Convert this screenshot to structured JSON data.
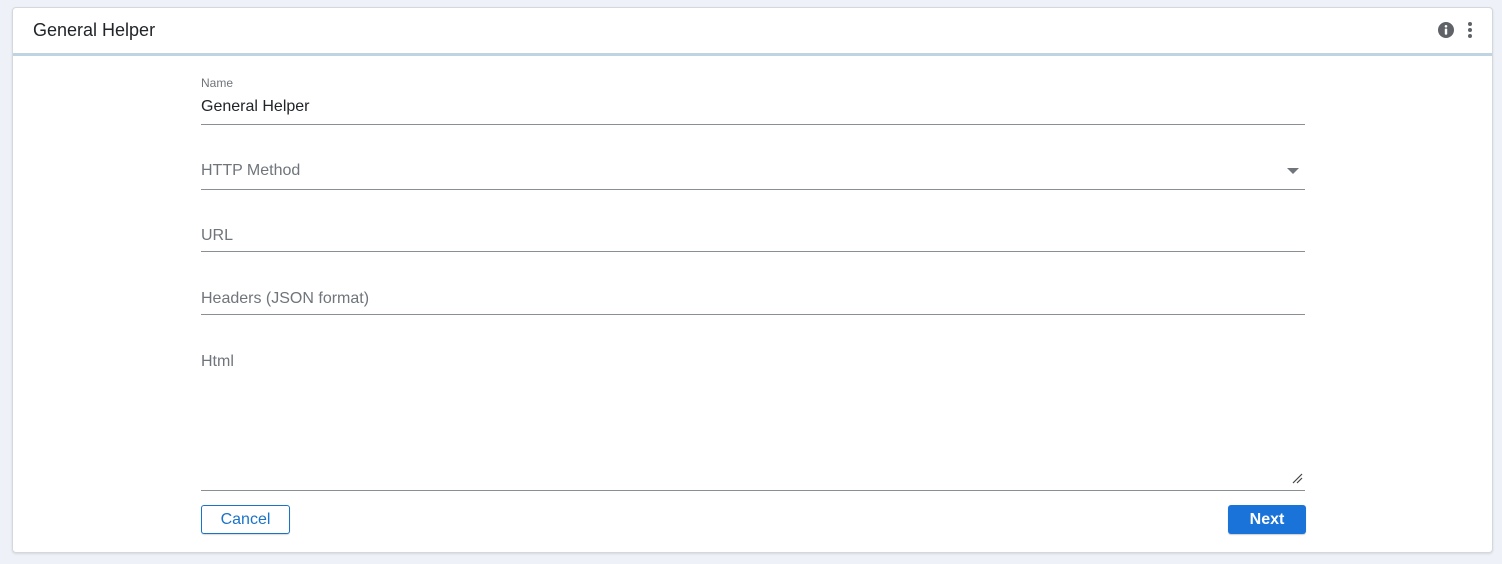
{
  "header": {
    "title": "General Helper",
    "icons": [
      "info-icon",
      "more-vertical-icon"
    ]
  },
  "form": {
    "name": {
      "label": "Name",
      "value": "General Helper"
    },
    "http_method": {
      "placeholder": "HTTP Method",
      "value": ""
    },
    "url": {
      "placeholder": "URL",
      "value": ""
    },
    "headers": {
      "placeholder": "Headers (JSON format)",
      "value": ""
    },
    "html": {
      "placeholder": "Html",
      "value": ""
    }
  },
  "actions": {
    "cancel_label": "Cancel",
    "next_label": "Next"
  },
  "colors": {
    "primary": "#1a73d9",
    "header_divider": "#bfd3e2",
    "background": "#eef1f7"
  }
}
